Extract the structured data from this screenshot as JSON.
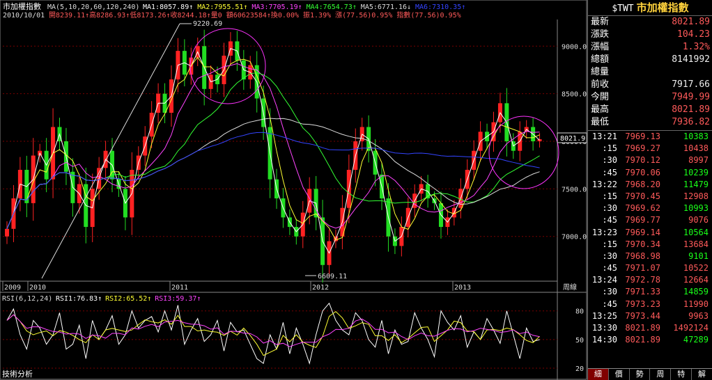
{
  "header": {
    "title": "市加權指數",
    "ma_text": "MA(5,10,20,60,120,240)",
    "ma_values": [
      {
        "label": "MA1:8057.89↑",
        "color": "#ffffff"
      },
      {
        "label": "MA2:7955.51↑",
        "color": "#ffff33"
      },
      {
        "label": "MA3:7705.19↑",
        "color": "#ff44ff"
      },
      {
        "label": "MA4:7654.73↑",
        "color": "#33ff33"
      },
      {
        "label": "MA5:6771.16↓",
        "color": "#dddddd"
      },
      {
        "label": "MA6:7310.35↑",
        "color": "#3344ff"
      }
    ],
    "date": "2010/10/01",
    "ohlc_line": "開8239.11↑高8286.93↑低8173.26↑收8244.18↑量0 額60623584↑換0.00% 振1.39% 漲(77.56)0.95% 指數(77.56)0.95%"
  },
  "chart_data": [
    {
      "type": "candlestick",
      "title": "市加權指數",
      "y_ticks": [
        9000.0,
        8500.0,
        8000.0,
        7500.0,
        7000.0
      ],
      "ylim": [
        6530,
        9280
      ],
      "x_labels": [
        "2009",
        "2010",
        "2011",
        "2012",
        "2013"
      ],
      "x_unit_label": "周線",
      "annotations": [
        {
          "label": "9220.69",
          "value": 9220.69,
          "at": "2011 high"
        },
        {
          "label": "6609.11",
          "value": 6609.11,
          "at": "2011 low"
        },
        {
          "label": "8021.9",
          "value": 8021.9,
          "at": "last price"
        }
      ],
      "close_series": [
        7080,
        7400,
        7700,
        7350,
        7850,
        7900,
        7600,
        8150,
        8000,
        7680,
        7350,
        7550,
        7100,
        7500,
        7720,
        7900,
        7600,
        7500,
        7200,
        7700,
        7850,
        8050,
        8300,
        8500,
        8300,
        8650,
        8950,
        8700,
        8880,
        9000,
        8550,
        8700,
        8600,
        8900,
        9050,
        8850,
        8650,
        8800,
        8450,
        8150,
        7600,
        7400,
        7200,
        7100,
        7000,
        7250,
        7500,
        7200,
        6700,
        6950,
        7000,
        7300,
        7700,
        8000,
        8150,
        7900,
        7650,
        7400,
        7000,
        6900,
        7100,
        7300,
        7450,
        7550,
        7400,
        7350,
        7100,
        7200,
        7300,
        7500,
        7700,
        7900,
        8100,
        8000,
        8200,
        8400,
        8000,
        7900,
        8100,
        8150,
        8000,
        8021.9
      ],
      "ma_series": [
        {
          "name": "MA1",
          "color": "#ffffff"
        },
        {
          "name": "MA2",
          "color": "#ffff33"
        },
        {
          "name": "MA3",
          "color": "#ff44ff"
        },
        {
          "name": "MA4",
          "color": "#33ff33"
        },
        {
          "name": "MA5",
          "color": "#dddddd"
        },
        {
          "name": "MA6",
          "color": "#3344ff"
        }
      ]
    },
    {
      "type": "line",
      "title": "RSI(6,12,24)",
      "y_ticks": [
        80,
        50,
        20
      ],
      "ylim": [
        12,
        98
      ],
      "series": [
        {
          "name": "RSI1:76.83↑",
          "color": "#ffffff"
        },
        {
          "name": "RSI2:65.52↑",
          "color": "#ffff33"
        },
        {
          "name": "RSI3:59.37↑",
          "color": "#ff44ff"
        }
      ],
      "rsi1_series": [
        70,
        82,
        55,
        40,
        70,
        62,
        45,
        55,
        78,
        40,
        45,
        65,
        30,
        70,
        50,
        60,
        75,
        45,
        55,
        80,
        62,
        70,
        74,
        58,
        80,
        60,
        86,
        45,
        60,
        72,
        48,
        55,
        70,
        38,
        68,
        58,
        60,
        45,
        30,
        25,
        55,
        40,
        68,
        35,
        62,
        45,
        25,
        55,
        80,
        88,
        70,
        60,
        55,
        78,
        70,
        50,
        42,
        70,
        35,
        60,
        45,
        48,
        78,
        62,
        50,
        32,
        80,
        68,
        60,
        75,
        42,
        58,
        50,
        72,
        60,
        46,
        80,
        55,
        30,
        62,
        48,
        50
      ]
    }
  ],
  "footer_label": "技術分析",
  "quote": {
    "symbol": "$TWT",
    "name": "市加權指數",
    "rows": [
      {
        "label": "最新",
        "value": "8021.89",
        "color": "red"
      },
      {
        "label": "漲跌",
        "value": "104.23",
        "color": "red"
      },
      {
        "label": "漲幅",
        "value": "1.32%",
        "color": "red"
      },
      {
        "label": "總額",
        "value": "8141992",
        "color": "white"
      },
      {
        "label": "總量",
        "value": "",
        "color": "white"
      },
      {
        "label": "前收",
        "value": "7917.66",
        "color": "white"
      },
      {
        "label": "今開",
        "value": "7949.99",
        "color": "red"
      },
      {
        "label": "最高",
        "value": "8021.89",
        "color": "red"
      },
      {
        "label": "最低",
        "value": "7936.82",
        "color": "red"
      }
    ]
  },
  "ticks": [
    {
      "time": "13:21",
      "price": "7969.13",
      "vol": "10383",
      "vcolor": "green"
    },
    {
      "time": ":15",
      "price": "7969.27",
      "vol": "10438",
      "vcolor": "red"
    },
    {
      "time": ":30",
      "price": "7970.12",
      "vol": "8997",
      "vcolor": "red"
    },
    {
      "time": ":45",
      "price": "7970.06",
      "vol": "10239",
      "vcolor": "green"
    },
    {
      "time": "13:22",
      "price": "7968.20",
      "vol": "11479",
      "vcolor": "green"
    },
    {
      "time": ":15",
      "price": "7970.45",
      "vol": "12908",
      "vcolor": "red"
    },
    {
      "time": ":30",
      "price": "7969.62",
      "vol": "10993",
      "vcolor": "green"
    },
    {
      "time": ":45",
      "price": "7969.77",
      "vol": "9076",
      "vcolor": "red"
    },
    {
      "time": "13:23",
      "price": "7969.14",
      "vol": "10564",
      "vcolor": "green"
    },
    {
      "time": ":15",
      "price": "7970.34",
      "vol": "13684",
      "vcolor": "red"
    },
    {
      "time": ":30",
      "price": "7968.98",
      "vol": "9101",
      "vcolor": "green"
    },
    {
      "time": ":45",
      "price": "7971.07",
      "vol": "10522",
      "vcolor": "red"
    },
    {
      "time": "13:24",
      "price": "7972.78",
      "vol": "12664",
      "vcolor": "red"
    },
    {
      "time": ":30",
      "price": "7971.33",
      "vol": "14859",
      "vcolor": "green"
    },
    {
      "time": ":45",
      "price": "7973.23",
      "vol": "11990",
      "vcolor": "red"
    },
    {
      "time": "13:25",
      "price": "7973.44",
      "vol": "9963",
      "vcolor": "red"
    },
    {
      "time": "13:30",
      "price": "8021.89",
      "vol": "1492124",
      "vcolor": "red"
    },
    {
      "time": "14:30",
      "price": "8021.89",
      "vol": "47289",
      "vcolor": "green"
    }
  ],
  "tabs": [
    "細",
    "價",
    "勢",
    "周",
    "特",
    "解"
  ],
  "active_tab": 0,
  "colors": {
    "up": "#ff2222",
    "down": "#22dd22",
    "grid": "#7a0000",
    "axis": "#888888",
    "circle": "#ff33ff"
  }
}
